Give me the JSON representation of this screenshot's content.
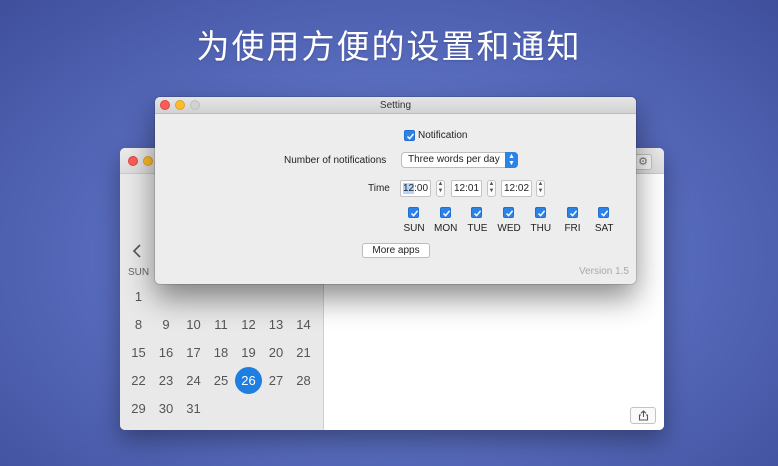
{
  "banner": {
    "headline": "为使用方便的设置和通知"
  },
  "calendar": {
    "weekday_label": "SUN",
    "days": [
      {
        "n": "1",
        "col": 0,
        "row": 0
      },
      {
        "n": "8",
        "col": 0,
        "row": 1
      },
      {
        "n": "9",
        "col": 1,
        "row": 1
      },
      {
        "n": "10",
        "col": 2,
        "row": 1
      },
      {
        "n": "11",
        "col": 3,
        "row": 1
      },
      {
        "n": "12",
        "col": 4,
        "row": 1
      },
      {
        "n": "13",
        "col": 5,
        "row": 1
      },
      {
        "n": "14",
        "col": 6,
        "row": 1
      },
      {
        "n": "15",
        "col": 0,
        "row": 2
      },
      {
        "n": "16",
        "col": 1,
        "row": 2
      },
      {
        "n": "17",
        "col": 2,
        "row": 2
      },
      {
        "n": "18",
        "col": 3,
        "row": 2
      },
      {
        "n": "19",
        "col": 4,
        "row": 2
      },
      {
        "n": "20",
        "col": 5,
        "row": 2
      },
      {
        "n": "21",
        "col": 6,
        "row": 2
      },
      {
        "n": "22",
        "col": 0,
        "row": 3
      },
      {
        "n": "23",
        "col": 1,
        "row": 3
      },
      {
        "n": "24",
        "col": 2,
        "row": 3
      },
      {
        "n": "25",
        "col": 3,
        "row": 3
      },
      {
        "n": "26",
        "col": 4,
        "row": 3,
        "today": true
      },
      {
        "n": "27",
        "col": 5,
        "row": 3
      },
      {
        "n": "28",
        "col": 6,
        "row": 3
      },
      {
        "n": "29",
        "col": 0,
        "row": 4
      },
      {
        "n": "30",
        "col": 1,
        "row": 4
      },
      {
        "n": "31",
        "col": 2,
        "row": 4
      }
    ]
  },
  "setting": {
    "title": "Setting",
    "notification_label": "Notification",
    "notification_checked": true,
    "count_label": "Number of notifications",
    "count_value": "Three words per day",
    "time_label": "Time",
    "times": [
      {
        "hour": "12",
        "minute": "00"
      },
      {
        "hour": "12",
        "minute": "01"
      },
      {
        "hour": "12",
        "minute": "02"
      }
    ],
    "weekdays": [
      {
        "label": "SUN",
        "checked": true
      },
      {
        "label": "MON",
        "checked": true
      },
      {
        "label": "TUE",
        "checked": true
      },
      {
        "label": "WED",
        "checked": true
      },
      {
        "label": "THU",
        "checked": true
      },
      {
        "label": "FRI",
        "checked": true
      },
      {
        "label": "SAT",
        "checked": true
      }
    ],
    "more_apps_label": "More apps",
    "version": "Version 1.5"
  },
  "colors": {
    "accent": "#2d82e8",
    "today": "#1e7fe0",
    "background": "#5a6ec0"
  }
}
